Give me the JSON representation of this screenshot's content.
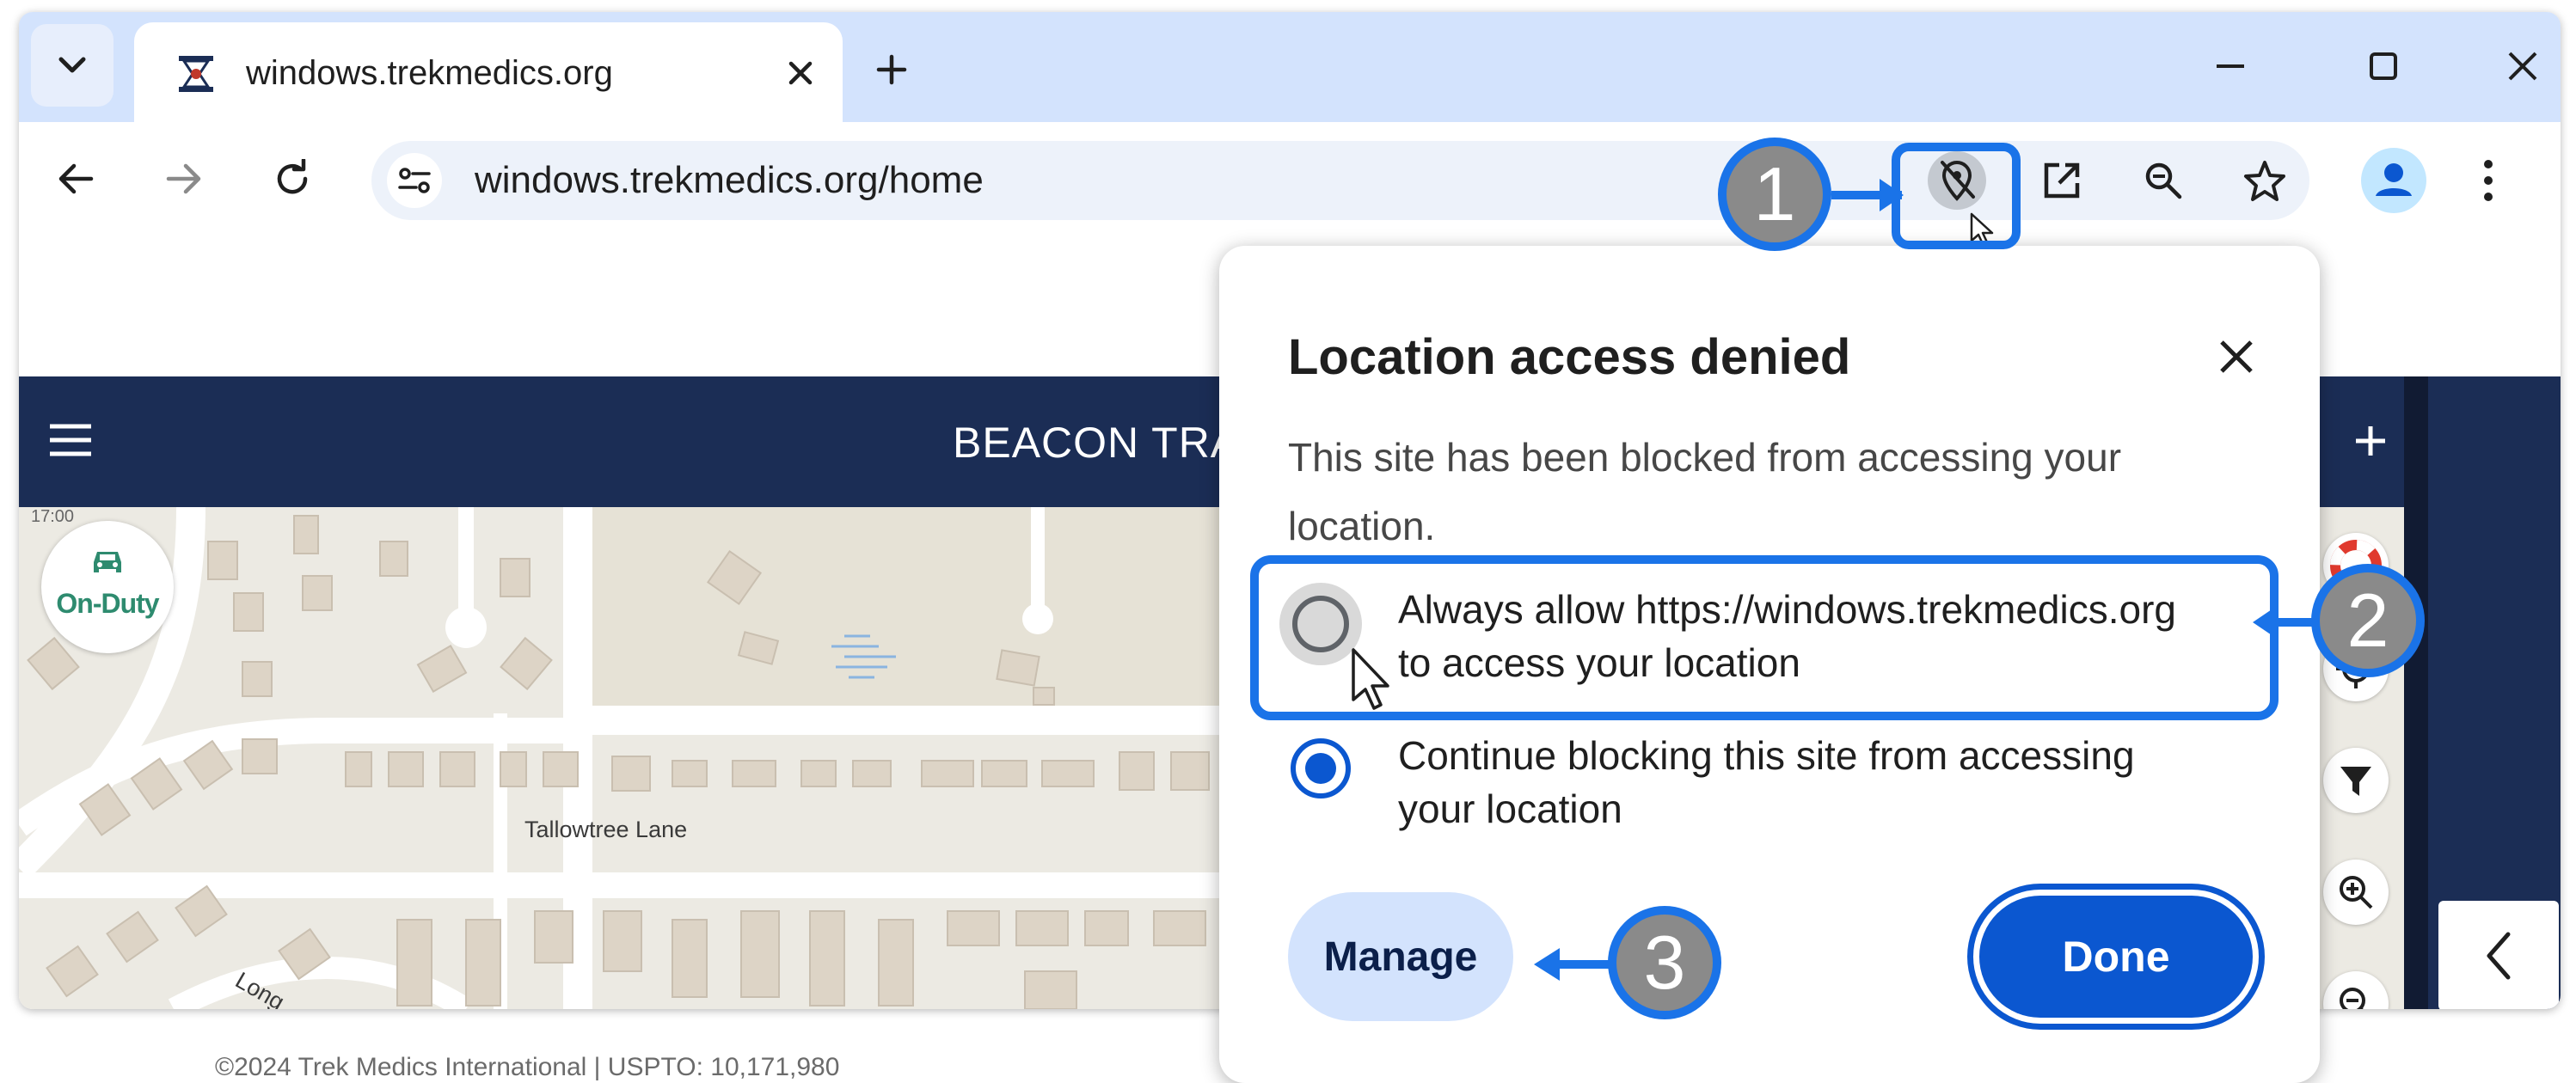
{
  "browser": {
    "tab": {
      "title": "windows.trekmedics.org"
    },
    "url": "windows.trekmedics.org/home"
  },
  "app": {
    "title": "BEACON TRA",
    "status": "On-Duty",
    "map_corner_text": "17:00",
    "streets": {
      "tallowtree": "Tallowtree Lane",
      "long": "Long"
    }
  },
  "footer": {
    "copyright": "©2024 Trek Medics International | USPTO: 10,171,980"
  },
  "popup": {
    "title": "Location access denied",
    "description": "This site has been blocked from accessing your location.",
    "options": [
      {
        "line1": "Always allow https://windows.trekmedics.org",
        "line2": "to access your location",
        "selected": false
      },
      {
        "line1": "Continue blocking this site from accessing",
        "line2": "your location",
        "selected": true
      }
    ],
    "manage_label": "Manage",
    "done_label": "Done"
  },
  "callouts": [
    "1",
    "2",
    "3"
  ],
  "colors": {
    "accent": "#1a73e8",
    "header": "#1b2d55",
    "done": "#0b57d0",
    "callout_fill": "#8a8a8a"
  }
}
